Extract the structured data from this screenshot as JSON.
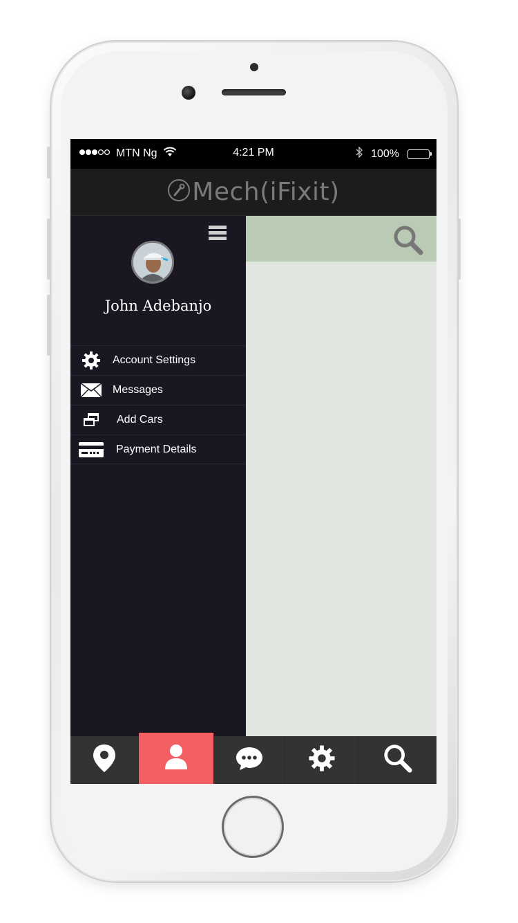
{
  "status_bar": {
    "carrier": "MTN Ng",
    "time": "4:21 PM",
    "battery": "100%"
  },
  "app_bar": {
    "title": "Mech(iFixit)"
  },
  "drawer": {
    "user_name": "John Adebanjo",
    "menu": [
      {
        "label": "Account Settings",
        "icon": "gear-icon"
      },
      {
        "label": "Messages",
        "icon": "envelope-icon"
      },
      {
        "label": "Add Cars",
        "icon": "windows-icon"
      },
      {
        "label": "Payment Details",
        "icon": "credit-card-icon"
      }
    ]
  },
  "tab_bar": {
    "tabs": [
      {
        "icon": "location-pin-icon",
        "active": false
      },
      {
        "icon": "user-icon",
        "active": true
      },
      {
        "icon": "chat-bubble-icon",
        "active": false
      },
      {
        "icon": "gear-icon",
        "active": false
      },
      {
        "icon": "search-icon",
        "active": false
      }
    ]
  },
  "colors": {
    "drawer_bg": "#1a1723",
    "active_tab": "#f35f62",
    "search_bar": "#b9cbb5",
    "content_bg": "#e1e6e0"
  }
}
